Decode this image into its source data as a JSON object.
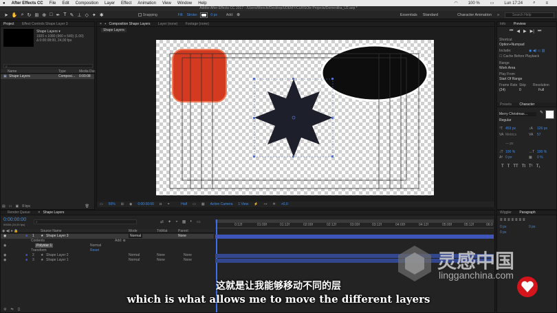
{
  "mac_menu": {
    "apple": "",
    "app": "After Effects CC",
    "file": "File",
    "edit": "Edit",
    "composition": "Composition",
    "layer": "Layer",
    "effect": "Effect",
    "animation": "Animation",
    "view": "View",
    "window": "Window",
    "help": "Help"
  },
  "mac_status": {
    "battery": "100 %",
    "clock": "Lun 17:24"
  },
  "window_title": "Adobe After Effects CC 2017 - /Users/Monchi/Desktop/UDEMY/CURSOle Projects/Domestika_U2.aep *",
  "toolbar": {
    "snapping": "Snapping",
    "fill": "Fill:",
    "stroke": "Stroke:",
    "stroke_px": "0 px",
    "add": "Add:",
    "workspaces": [
      "Essentials",
      "Standard",
      "Character Animation"
    ],
    "search_placeholder": "Search Help"
  },
  "project": {
    "tab": "Project",
    "effect_tab": "Effect Controls Shape Layer 3",
    "item_name": "Shape Layers ▾",
    "item_info1": "1920 x 1080 (960 x 540) (1.00)",
    "item_info2": "Δ 0:00:08:00, 24,00 fps",
    "col_name": "Name",
    "col_type": "Type",
    "col_media": "Media Dur.",
    "row_name": "Shape Layers",
    "row_type": "Composi…",
    "row_dur": "0:00:08",
    "bpc": "8 bpc"
  },
  "comp": {
    "tab": "Composition Shape Layers",
    "layer_tab": "Layer (none)",
    "footage_tab": "Footage (none)",
    "subtab": "Shape Layers",
    "zoom": "50%",
    "time": "0:00:00:00",
    "resolution": "Half",
    "camera": "Active Camera",
    "views": "1 View",
    "offset": "+0,0"
  },
  "timeline": {
    "render_queue": "Render Queue",
    "comp_tab": "Shape Layers",
    "current_time": "0:00:00:00",
    "fps": "00000 (24,00 fps)",
    "col_source": "Source Name",
    "col_mode": "Mode",
    "col_trkmat": "TrkMat",
    "col_parent": "Parent",
    "ruler": [
      "0:12f",
      "01:00f",
      "01:12f",
      "02:00f",
      "02:12f",
      "03:00f",
      "03:12f",
      "04:00f",
      "04:12f",
      "05:00f",
      "05:12f",
      "06:0"
    ],
    "layers": [
      {
        "num": "1",
        "name": "Shape Layer 3",
        "mode": "Normal",
        "trkmat": "",
        "parent": "None"
      },
      {
        "num": "",
        "name": "Contents",
        "mode": "",
        "trkmat": "",
        "parent": "Add: ⊕"
      },
      {
        "num": "",
        "name": "Polystar 1",
        "mode": "Normal",
        "trkmat": "",
        "parent": ""
      },
      {
        "num": "",
        "name": "Transform",
        "mode": "Reset",
        "trkmat": "",
        "parent": ""
      },
      {
        "num": "2",
        "name": "Shape Layer 2",
        "mode": "Normal",
        "trkmat": "None",
        "parent": "None"
      },
      {
        "num": "3",
        "name": "Shape Layer 1",
        "mode": "Normal",
        "trkmat": "None",
        "parent": "None"
      }
    ]
  },
  "right": {
    "info": "Info",
    "preview": "Preview",
    "shortcut": "Shortcut",
    "shortcut_val": "Option+Numpad",
    "include": "Include:",
    "cache": "Cache Before Playback",
    "range": "Range",
    "range_val": "Work Area",
    "play_from": "Play From",
    "play_from_val": "Start Of Range",
    "frame_rate": "Frame Rate",
    "skip": "Skip",
    "resolution": "Resolution",
    "fr_val": "(24)",
    "skip_val": "0",
    "res_val": "Full",
    "presets": "Presets",
    "character": "Character",
    "font": "Merry Christmas…",
    "style": "Regular",
    "size": "453 px",
    "leading": "126 px",
    "metrics": "Metrics",
    "tracking": "57",
    "px_label": "— px",
    "scale_v": "100 %",
    "scale_h": "100 %",
    "baseline": "0 px",
    "tsume": "0 %",
    "wiggler": "Wiggler",
    "paragraph": "Paragraph",
    "p1": "0 px",
    "p2": "0 px",
    "p3": "0 px"
  },
  "subtitle": {
    "zh": "这就是让我能够移动不同的层",
    "en": "which is what allows me to move the different layers"
  },
  "watermark": {
    "cn": "灵感中国",
    "url": "lingganchina.com"
  }
}
